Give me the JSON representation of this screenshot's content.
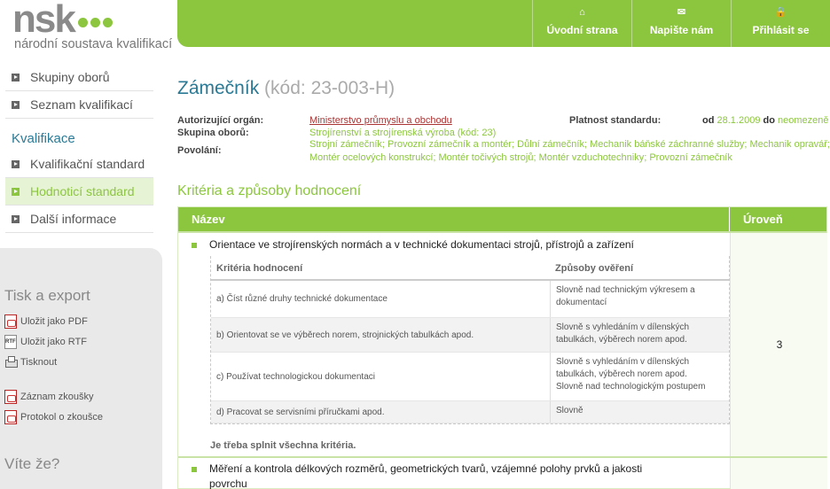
{
  "logo": {
    "brand": "nsk",
    "tagline": "národní soustava kvalifikací"
  },
  "topnav": [
    {
      "label": "Úvodní strana",
      "icon": "home-icon",
      "glyph": "⌂"
    },
    {
      "label": "Napište nám",
      "icon": "mail-icon",
      "glyph": "✉"
    },
    {
      "label": "Přihlásit se",
      "icon": "lock-icon",
      "glyph": "🔒"
    }
  ],
  "sidebar": {
    "top_items": [
      {
        "label": "Skupiny oborů"
      },
      {
        "label": "Seznam kvalifikací"
      }
    ],
    "section_heading": "Kvalifikace",
    "section_items": [
      {
        "label": "Kvalifikační standard"
      },
      {
        "label": "Hodnoticí standard",
        "active": true
      },
      {
        "label": "Další informace"
      }
    ],
    "print_heading": "Tisk a export",
    "exports": [
      {
        "label": "Uložit jako PDF",
        "icon": "pdf-icon"
      },
      {
        "label": "Uložit jako RTF",
        "icon": "rtf-icon"
      },
      {
        "label": "Tisknout",
        "icon": "printer-icon"
      },
      {
        "label": "Záznam zkoušky",
        "icon": "pdf-icon"
      },
      {
        "label": "Protokol o zkoušce",
        "icon": "pdf-icon"
      }
    ],
    "did_you_know_heading": "Víte že?"
  },
  "page": {
    "title": "Zámečník",
    "code": "(kód: 23-003-H)"
  },
  "meta": {
    "authority_label": "Autorizující orgán:",
    "authority_value": "Ministerstvo průmyslu a obchodu",
    "group_label": "Skupina oborů:",
    "group_value": "Strojírenství a strojírenská výroba (kód: 23)",
    "professions_label": "Povolání:",
    "professions_line1": "Strojní zámečník; Provozní zámečník a montér; Důlní zámečník; Mechanik báňské záchranné služby; Mechanik opravář;",
    "professions_line2": "Montér ocelových konstrukcí; Montér točivých strojů; Montér vzduchotechniky; Provozní zámečník",
    "validity_label": "Platnost standardu:",
    "validity_from_word": "od",
    "validity_from": "28.1.2009",
    "validity_to_word": "do",
    "validity_to": "neomezeně"
  },
  "section_title": "Kritéria a způsoby hodnocení",
  "table": {
    "col_name": "Název",
    "col_level": "Úroveň",
    "rows": [
      {
        "name": "Orientace ve strojírenských normách a v technické dokumentaci strojů, přístrojů a zařízení",
        "level": "3",
        "inner_head_criteria": "Kritéria hodnocení",
        "inner_head_methods": "Způsoby ověření",
        "criteria": [
          {
            "text": "a) Číst různé druhy technické dokumentace",
            "method": [
              "Slovně nad technickým výkresem a",
              "dokumentací"
            ]
          },
          {
            "text": "b) Orientovat se ve výběrech norem, strojnických tabulkách apod.",
            "method": [
              "Slovně s vyhledáním v dílenských",
              "tabulkách, výběrech norem apod."
            ]
          },
          {
            "text": "c) Používat technologickou dokumentaci",
            "method": [
              "Slovně s vyhledáním v dílenských",
              "tabulkách, výběrech norem apod.",
              "Slovně nad technologickým postupem"
            ]
          },
          {
            "text": "d) Pracovat se servisními příručkami apod.",
            "method": [
              "Slovně"
            ]
          }
        ],
        "note": "Je třeba splnit všechna kritéria."
      },
      {
        "name_line1": "Měření a kontrola délkových rozměrů, geometrických tvarů, vzájemné polohy prvků a jakosti",
        "name_line2": "povrchu"
      }
    ]
  },
  "colors": {
    "accent": "#8cc63f",
    "title_blue": "#2a7a96",
    "link_red": "#aa3333"
  }
}
